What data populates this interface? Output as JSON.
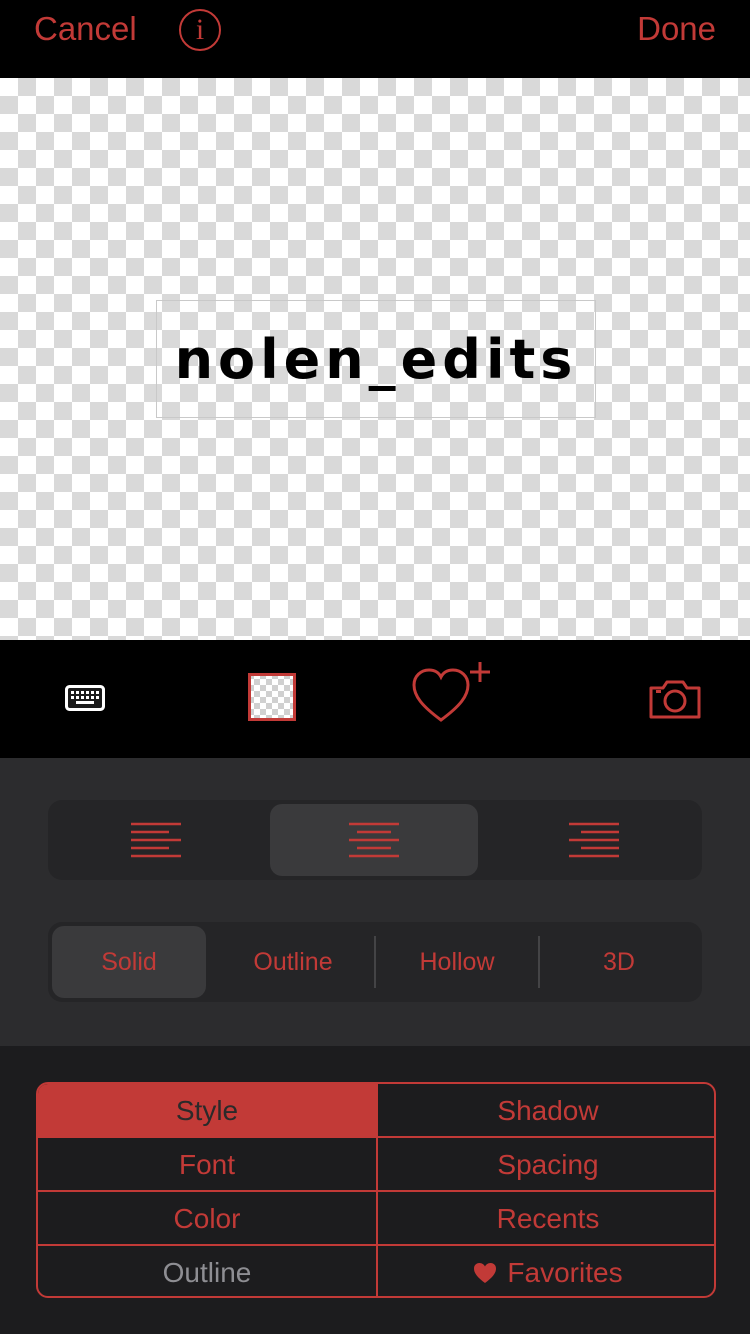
{
  "topbar": {
    "cancel_label": "Cancel",
    "info_glyph": "i",
    "done_label": "Done"
  },
  "canvas": {
    "text": "nolen_edits",
    "background": "transparent-checkerboard"
  },
  "toolbar": {
    "icons": [
      "keyboard-icon",
      "background-swatch-icon",
      "add-favorite-heart-icon",
      "camera-icon"
    ]
  },
  "alignment": {
    "options": [
      "left",
      "center",
      "right"
    ],
    "selected": "center"
  },
  "style_segments": {
    "items": [
      "Solid",
      "Outline",
      "Hollow",
      "3D"
    ],
    "selected": "Solid"
  },
  "menu": {
    "style": "Style",
    "shadow": "Shadow",
    "font": "Font",
    "spacing": "Spacing",
    "color": "Color",
    "recents": "Recents",
    "outline": "Outline",
    "favorites": "Favorites",
    "active": "Style"
  },
  "colors": {
    "accent": "#c23a37",
    "panel": "#2c2c2e",
    "background": "#000000"
  }
}
